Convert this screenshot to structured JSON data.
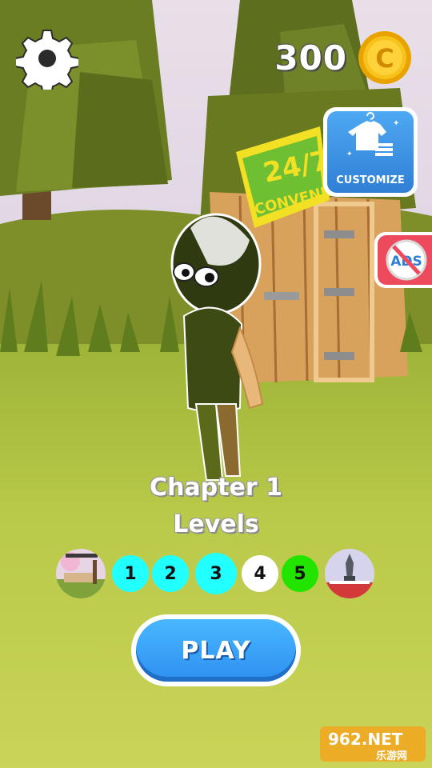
{
  "hud": {
    "settings_icon": "gear-icon",
    "coin_count": "300",
    "coin_symbol": "C",
    "customize_label": "CUSTOMIZE",
    "no_ads_label": "ADS"
  },
  "scene": {
    "store_sign_line1": "24/7",
    "store_sign_line2": "CONVENIE"
  },
  "chapter": {
    "title": "Chapter 1",
    "subtitle": "Levels"
  },
  "levels": [
    {
      "label": "1",
      "color": "#22ffff"
    },
    {
      "label": "2",
      "color": "#22ffff"
    },
    {
      "label": "3",
      "color": "#22ffff"
    },
    {
      "label": "4",
      "color": "#ffffff"
    },
    {
      "label": "5",
      "color": "#22e400"
    }
  ],
  "play_button": {
    "label": "PLAY"
  },
  "watermark": {
    "brand": "962.NET",
    "sub": "乐游网"
  },
  "colors": {
    "accent_blue": "#2f8ff0",
    "coin_gold": "#f5b400",
    "no_ads_red": "#ee4a5e",
    "grass": "#b7c83e"
  }
}
